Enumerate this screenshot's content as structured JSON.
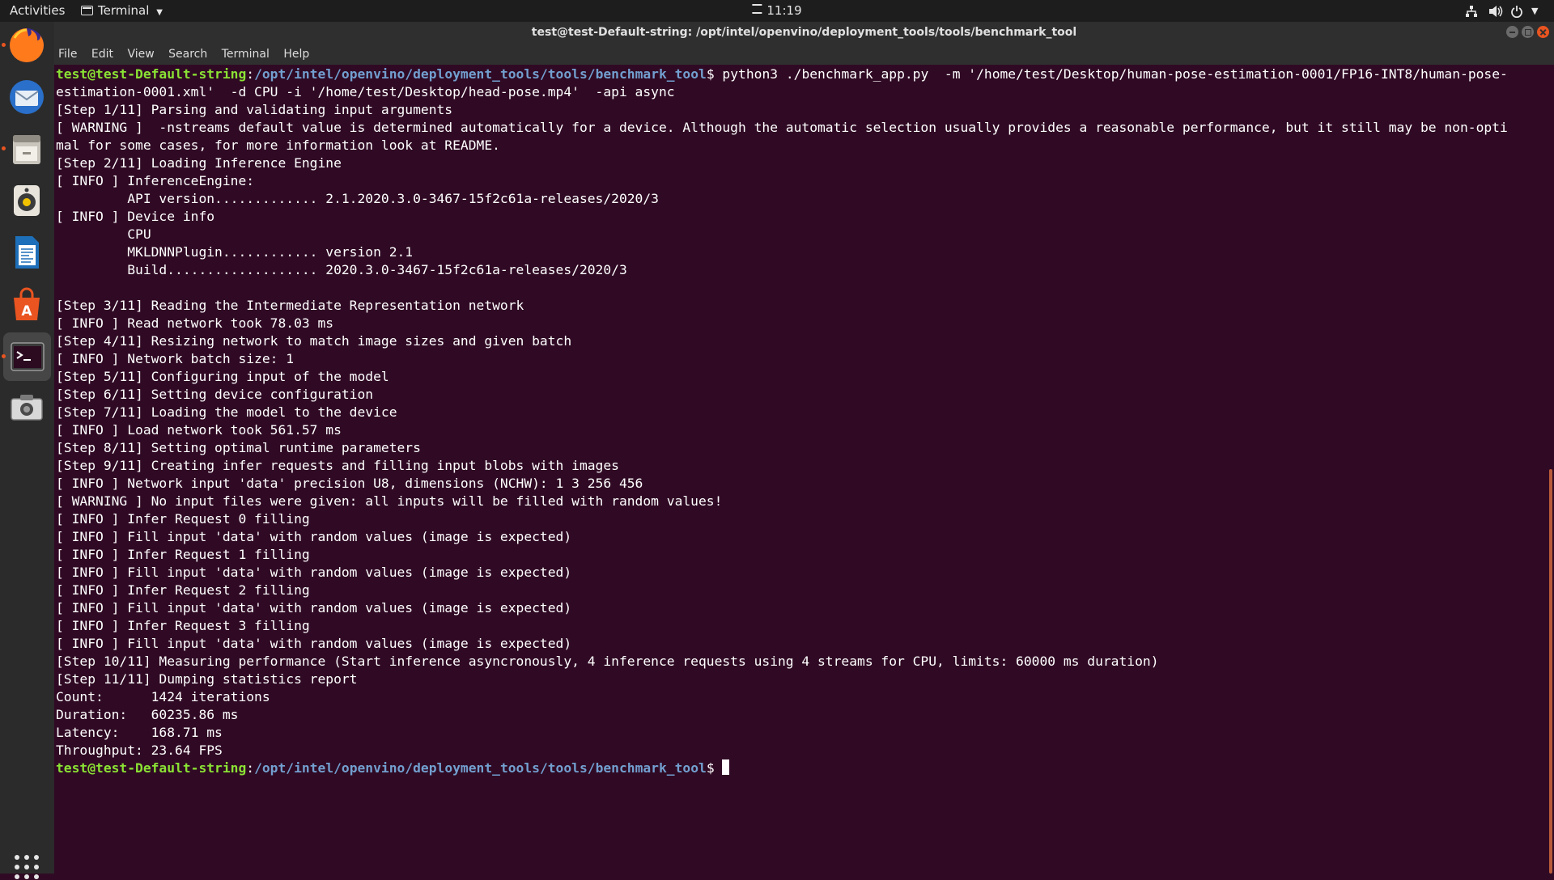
{
  "topbar": {
    "activities": "Activities",
    "app_menu": "Terminal",
    "clock": "11:19"
  },
  "window": {
    "title": "test@test-Default-string: /opt/intel/openvino/deployment_tools/tools/benchmark_tool"
  },
  "menu": {
    "items": [
      "File",
      "Edit",
      "View",
      "Search",
      "Terminal",
      "Help"
    ]
  },
  "dock": {
    "apps": [
      "firefox-icon",
      "thunderbird-icon",
      "files-icon",
      "rhythmbox-icon",
      "libreoffice-writer-icon",
      "ubuntu-software-icon",
      "terminal-icon",
      "screenshot-icon"
    ],
    "active": "terminal-icon"
  },
  "terminal": {
    "prompt_user": "test@test-Default-string",
    "prompt_path": "/opt/intel/openvino/deployment_tools/tools/benchmark_tool",
    "prompt_symbol": "$",
    "command": " python3 ./benchmark_app.py  -m '/home/test/Desktop/human-pose-estimation-0001/FP16-INT8/human-pose-",
    "lines": [
      "estimation-0001.xml'  -d CPU -i '/home/test/Desktop/head-pose.mp4'  -api async",
      "[Step 1/11] Parsing and validating input arguments",
      "[ WARNING ]  -nstreams default value is determined automatically for a device. Although the automatic selection usually provides a reasonable performance, but it still may be non-opti",
      "mal for some cases, for more information look at README.",
      "[Step 2/11] Loading Inference Engine",
      "[ INFO ] InferenceEngine:",
      "         API version............. 2.1.2020.3.0-3467-15f2c61a-releases/2020/3",
      "[ INFO ] Device info",
      "         CPU",
      "         MKLDNNPlugin............ version 2.1",
      "         Build................... 2020.3.0-3467-15f2c61a-releases/2020/3",
      "",
      "[Step 3/11] Reading the Intermediate Representation network",
      "[ INFO ] Read network took 78.03 ms",
      "[Step 4/11] Resizing network to match image sizes and given batch",
      "[ INFO ] Network batch size: 1",
      "[Step 5/11] Configuring input of the model",
      "[Step 6/11] Setting device configuration",
      "[Step 7/11] Loading the model to the device",
      "[ INFO ] Load network took 561.57 ms",
      "[Step 8/11] Setting optimal runtime parameters",
      "[Step 9/11] Creating infer requests and filling input blobs with images",
      "[ INFO ] Network input 'data' precision U8, dimensions (NCHW): 1 3 256 456",
      "[ WARNING ] No input files were given: all inputs will be filled with random values!",
      "[ INFO ] Infer Request 0 filling",
      "[ INFO ] Fill input 'data' with random values (image is expected)",
      "[ INFO ] Infer Request 1 filling",
      "[ INFO ] Fill input 'data' with random values (image is expected)",
      "[ INFO ] Infer Request 2 filling",
      "[ INFO ] Fill input 'data' with random values (image is expected)",
      "[ INFO ] Infer Request 3 filling",
      "[ INFO ] Fill input 'data' with random values (image is expected)",
      "[Step 10/11] Measuring performance (Start inference asyncronously, 4 inference requests using 4 streams for CPU, limits: 60000 ms duration)",
      "[Step 11/11] Dumping statistics report",
      "Count:      1424 iterations",
      "Duration:   60235.86 ms",
      "Latency:    168.71 ms",
      "Throughput: 23.64 FPS"
    ]
  },
  "colors": {
    "terminal_bg": "#300a24",
    "prompt_user": "#8ae234",
    "prompt_path": "#729fcf",
    "accent": "#e95420"
  }
}
